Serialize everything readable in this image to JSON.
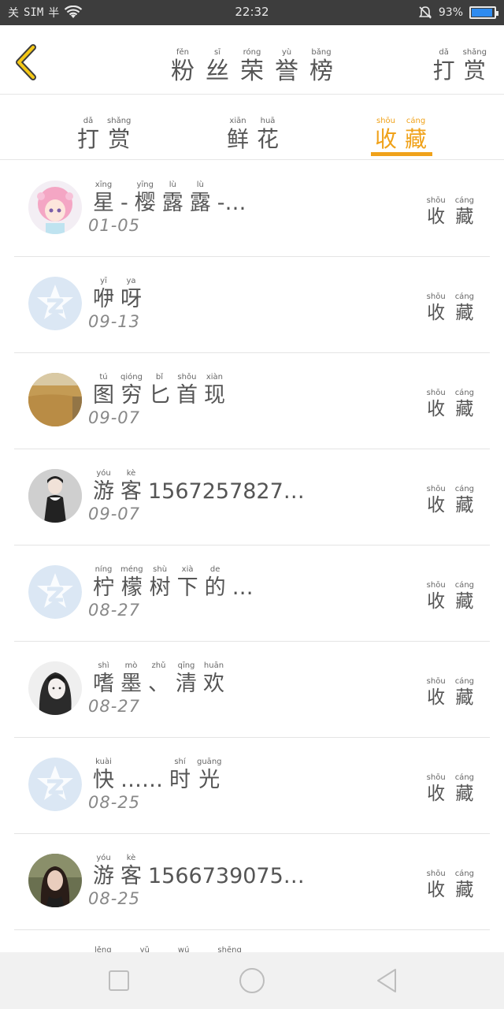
{
  "status_bar": {
    "carrier_left": "关",
    "sim_text": "SIM",
    "carrier_icon": "半",
    "time": "22:32",
    "battery_text": "93%",
    "battery_level": 0.93,
    "icons": [
      "wifi-icon",
      "mute-icon",
      "battery-icon"
    ]
  },
  "header": {
    "title": [
      {
        "py": "fěn",
        "hz": "粉"
      },
      {
        "py": "sī",
        "hz": "丝"
      },
      {
        "py": "róng",
        "hz": "荣"
      },
      {
        "py": "yù",
        "hz": "誉"
      },
      {
        "py": "bǎng",
        "hz": "榜"
      }
    ],
    "action": [
      {
        "py": "dǎ",
        "hz": "打"
      },
      {
        "py": "shǎng",
        "hz": "赏"
      }
    ]
  },
  "tabs": [
    {
      "chars": [
        {
          "py": "dǎ",
          "hz": "打"
        },
        {
          "py": "shǎng",
          "hz": "赏"
        }
      ],
      "active": false
    },
    {
      "chars": [
        {
          "py": "xiān",
          "hz": "鲜"
        },
        {
          "py": "huā",
          "hz": "花"
        }
      ],
      "active": false
    },
    {
      "chars": [
        {
          "py": "shōu",
          "hz": "收"
        },
        {
          "py": "cáng",
          "hz": "藏"
        }
      ],
      "active": true
    }
  ],
  "accent_color": "#f0a21a",
  "favorite_label": [
    {
      "py": "shōu",
      "hz": "收"
    },
    {
      "py": "cáng",
      "hz": "藏"
    }
  ],
  "list": [
    {
      "name": [
        {
          "py": "xīng",
          "hz": "星"
        },
        {
          "py": "",
          "hz": "-"
        },
        {
          "py": "yīng",
          "hz": "樱"
        },
        {
          "py": "lù",
          "hz": "露"
        },
        {
          "py": "lù",
          "hz": "露"
        },
        {
          "py": "",
          "hz": "-…"
        }
      ],
      "date": "01-05",
      "avatar": "anime-girl"
    },
    {
      "name": [
        {
          "py": "yī",
          "hz": "咿"
        },
        {
          "py": "ya",
          "hz": "呀"
        }
      ],
      "date": "09-13",
      "avatar": "default"
    },
    {
      "name": [
        {
          "py": "tú",
          "hz": "图"
        },
        {
          "py": "qióng",
          "hz": "穷"
        },
        {
          "py": "bǐ",
          "hz": "匕"
        },
        {
          "py": "shǒu",
          "hz": "首"
        },
        {
          "py": "xiàn",
          "hz": "现"
        }
      ],
      "date": "09-07",
      "avatar": "field"
    },
    {
      "name": [
        {
          "py": "yóu",
          "hz": "游"
        },
        {
          "py": "kè",
          "hz": "客"
        }
      ],
      "name_suffix": "1567257827…",
      "date": "09-07",
      "avatar": "photo-girl"
    },
    {
      "name": [
        {
          "py": "níng",
          "hz": "柠"
        },
        {
          "py": "méng",
          "hz": "檬"
        },
        {
          "py": "shù",
          "hz": "树"
        },
        {
          "py": "xià",
          "hz": "下"
        },
        {
          "py": "de",
          "hz": "的"
        },
        {
          "py": "",
          "hz": "…"
        }
      ],
      "date": "08-27",
      "avatar": "default"
    },
    {
      "name": [
        {
          "py": "shì",
          "hz": "嗜"
        },
        {
          "py": "mò",
          "hz": "墨"
        },
        {
          "py": "zhǔ",
          "hz": "、"
        },
        {
          "py": "qīng",
          "hz": "清"
        },
        {
          "py": "huān",
          "hz": "欢"
        }
      ],
      "date": "08-27",
      "avatar": "sketch-girl"
    },
    {
      "name": [
        {
          "py": "kuài",
          "hz": "快"
        },
        {
          "py": "",
          "hz": "……"
        },
        {
          "py": "shí",
          "hz": "时"
        },
        {
          "py": "guāng",
          "hz": "光"
        }
      ],
      "date": "08-25",
      "avatar": "default"
    },
    {
      "name": [
        {
          "py": "yóu",
          "hz": "游"
        },
        {
          "py": "kè",
          "hz": "客"
        }
      ],
      "name_suffix": "1566739075…",
      "date": "08-25",
      "avatar": "photo-woman"
    }
  ],
  "partial_row_pinyin": [
    "lěng",
    "yǔ",
    "wú",
    "shēng"
  ],
  "navbar": {
    "icons": [
      "recent-apps-icon",
      "home-icon",
      "back-nav-icon"
    ]
  }
}
